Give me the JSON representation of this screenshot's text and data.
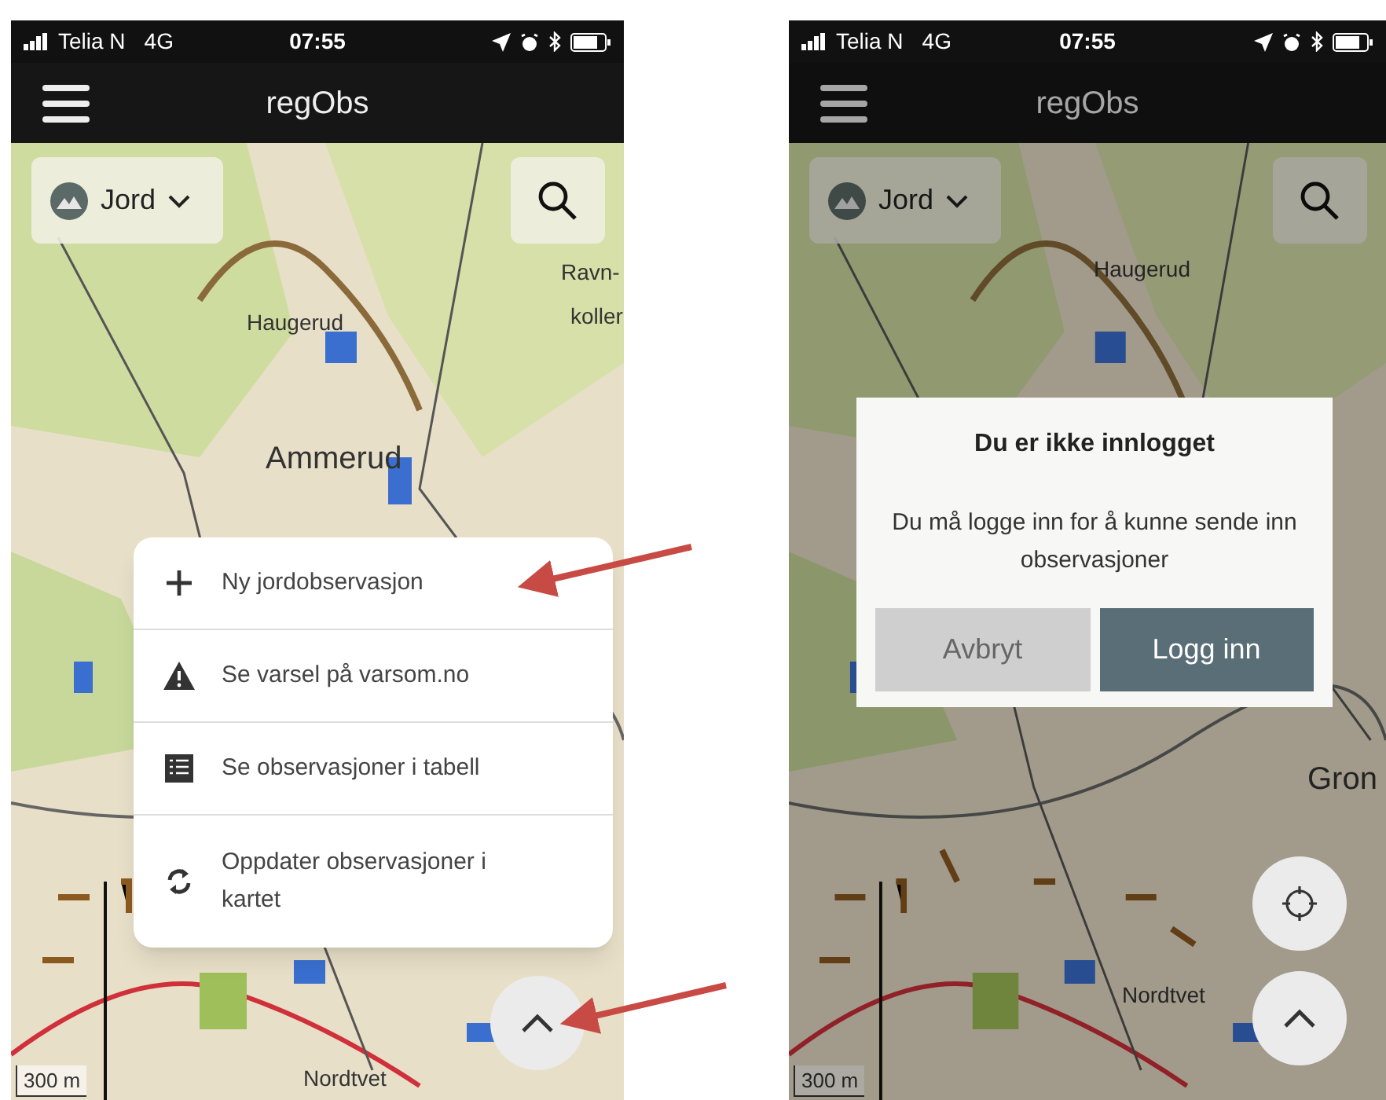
{
  "screens": [
    {
      "status_bar": {
        "carrier": "Telia N",
        "network": "4G",
        "time": "07:55"
      },
      "title": "regObs",
      "layer_selector": "Jord",
      "dimmed": false,
      "map_labels": [
        {
          "text": "Haugerud",
          "kind": "small"
        },
        {
          "text": "Ammerud",
          "kind": "large"
        },
        {
          "text": "Ravn-",
          "kind": "small"
        },
        {
          "text": "koller",
          "kind": "small"
        },
        {
          "text": "Nordtvet",
          "kind": "small"
        }
      ],
      "scale": "300 m",
      "menu": [
        {
          "kind": "add",
          "label": "Ny jordobservasjon"
        },
        {
          "kind": "warning",
          "label": "Se varsel på varsom.no"
        },
        {
          "kind": "table",
          "label": "Se observasjoner i tabell"
        },
        {
          "kind": "refresh",
          "label": "Oppdater observasjoner i kartet"
        }
      ],
      "buttons": [
        {
          "kind": "expand"
        }
      ]
    },
    {
      "status_bar": {
        "carrier": "Telia N",
        "network": "4G",
        "time": "07:55"
      },
      "title": "regObs",
      "layer_selector": "Jord",
      "dimmed": true,
      "map_labels": [
        {
          "text": "Haugerud",
          "kind": "small"
        },
        {
          "text": "Gron",
          "kind": "large"
        },
        {
          "text": "Nordtvet",
          "kind": "small"
        }
      ],
      "scale": "300 m",
      "dialog": {
        "title": "Du er ikke innlogget",
        "message": "Du må logge inn for å kunne sende inn observasjoner",
        "buttons": [
          {
            "label": "Avbryt",
            "primary": false
          },
          {
            "label": "Logg inn",
            "primary": true
          }
        ]
      },
      "buttons": [
        {
          "kind": "locate"
        },
        {
          "kind": "expand"
        }
      ]
    }
  ]
}
